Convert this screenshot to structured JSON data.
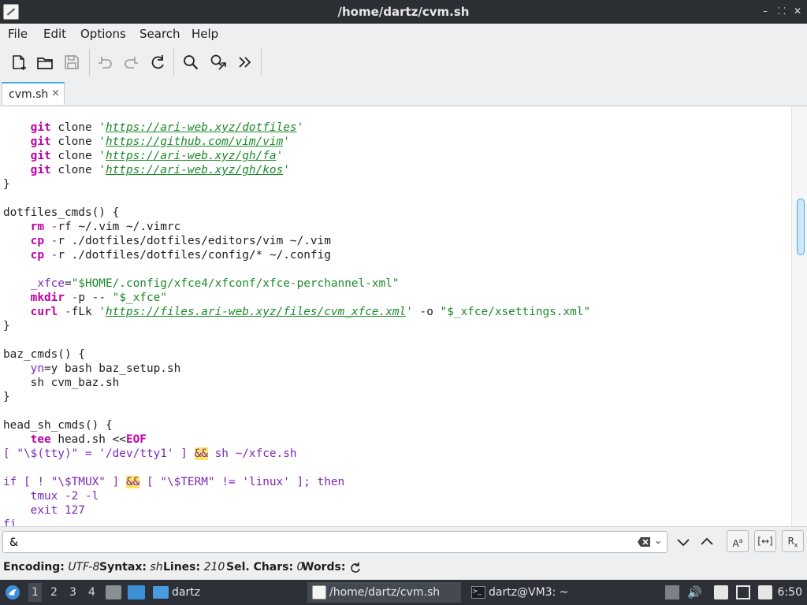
{
  "window": {
    "title": "/home/dartz/cvm.sh"
  },
  "menu": {
    "items": [
      "File",
      "Edit",
      "Options",
      "Search",
      "Help"
    ]
  },
  "tabs": [
    {
      "label": "cvm.sh",
      "close": "×"
    }
  ],
  "search": {
    "value": "&"
  },
  "status": {
    "encoding_label": "Encoding:",
    "encoding_value": "UTF-8",
    "syntax_label": "Syntax:",
    "syntax_value": "sh",
    "lines_label": "Lines:",
    "lines_value": "210",
    "selchars_label": "Sel. Chars:",
    "selchars_value": "0",
    "words_label": "Words:"
  },
  "taskbar": {
    "workspaces": [
      "1",
      "2",
      "3",
      "4"
    ],
    "folder_label": "dartz",
    "tasks": [
      {
        "label": "/home/dartz/cvm.sh"
      },
      {
        "label": "dartz@VM3: ~"
      }
    ],
    "clock": "6:50"
  },
  "code_lines": [
    [
      [
        "    ",
        ""
      ],
      [
        "git",
        "k"
      ],
      [
        " clone ",
        ""
      ],
      [
        "'",
        "s"
      ],
      [
        "https://ari-web.xyz/dotfiles",
        "u"
      ],
      [
        "'",
        "s"
      ]
    ],
    [
      [
        "    ",
        ""
      ],
      [
        "git",
        "k"
      ],
      [
        " clone ",
        ""
      ],
      [
        "'",
        "s"
      ],
      [
        "https://github.com/vim/vim",
        "u"
      ],
      [
        "'",
        "s"
      ]
    ],
    [
      [
        "    ",
        ""
      ],
      [
        "git",
        "k"
      ],
      [
        " clone ",
        ""
      ],
      [
        "'",
        "s"
      ],
      [
        "https://ari-web.xyz/gh/fa",
        "u"
      ],
      [
        "'",
        "s"
      ]
    ],
    [
      [
        "    ",
        ""
      ],
      [
        "git",
        "k"
      ],
      [
        " clone ",
        ""
      ],
      [
        "'",
        "s"
      ],
      [
        "https://ari-web.xyz/gh/kos",
        "u"
      ],
      [
        "'",
        "s"
      ]
    ],
    [
      [
        "}",
        ""
      ]
    ],
    [
      [
        "",
        ""
      ]
    ],
    [
      [
        "dotfiles_cmds() {",
        ""
      ]
    ],
    [
      [
        "    ",
        ""
      ],
      [
        "rm",
        "k"
      ],
      [
        " ",
        ""
      ],
      [
        "-",
        "p"
      ],
      [
        "rf ",
        ""
      ],
      [
        "~/",
        ""
      ],
      [
        ".vim ",
        ""
      ],
      [
        "~/",
        ""
      ],
      [
        ".vimrc",
        ""
      ]
    ],
    [
      [
        "    ",
        ""
      ],
      [
        "cp",
        "k"
      ],
      [
        " ",
        ""
      ],
      [
        "-",
        "p"
      ],
      [
        "r ./dotfiles/dotfiles/editors/vim ",
        ""
      ],
      [
        "~/",
        ""
      ],
      [
        ".vim",
        ""
      ]
    ],
    [
      [
        "    ",
        ""
      ],
      [
        "cp",
        "k"
      ],
      [
        " ",
        ""
      ],
      [
        "-",
        "p"
      ],
      [
        "r ./dotfiles/dotfiles/config/",
        ""
      ],
      [
        "*",
        ""
      ],
      [
        " ",
        ""
      ],
      [
        "~/",
        ""
      ],
      [
        ".config",
        ""
      ]
    ],
    [
      [
        "",
        ""
      ]
    ],
    [
      [
        "    ",
        ""
      ],
      [
        "_xfce",
        "v"
      ],
      [
        "=",
        ""
      ],
      [
        "\"$HOME/.config/xfce4/xfconf/xfce-perchannel-xml\"",
        "s"
      ]
    ],
    [
      [
        "    ",
        ""
      ],
      [
        "mkdir",
        "k"
      ],
      [
        " ",
        ""
      ],
      [
        "-",
        "p"
      ],
      [
        "p -- ",
        ""
      ],
      [
        "\"$_xfce\"",
        "s"
      ]
    ],
    [
      [
        "    ",
        ""
      ],
      [
        "curl",
        "k"
      ],
      [
        " ",
        ""
      ],
      [
        "-",
        "p"
      ],
      [
        "fLk ",
        ""
      ],
      [
        "'",
        "s"
      ],
      [
        "https://files.ari-web.xyz/files/cvm_xfce.xml",
        "u"
      ],
      [
        "'",
        "s"
      ],
      [
        " -o ",
        ""
      ],
      [
        "\"$_xfce/xsettings.xml\"",
        "s"
      ]
    ],
    [
      [
        "}",
        ""
      ]
    ],
    [
      [
        "",
        ""
      ]
    ],
    [
      [
        "baz_cmds() {",
        ""
      ]
    ],
    [
      [
        "    ",
        ""
      ],
      [
        "yn",
        "v"
      ],
      [
        "=",
        ""
      ],
      [
        "y bash baz_setup.sh",
        ""
      ]
    ],
    [
      [
        "    sh cvm_baz.sh",
        ""
      ]
    ],
    [
      [
        "}",
        ""
      ]
    ],
    [
      [
        "",
        ""
      ]
    ],
    [
      [
        "head_sh_cmds() {",
        ""
      ]
    ],
    [
      [
        "    ",
        ""
      ],
      [
        "tee",
        "k"
      ],
      [
        " head.sh <<",
        ""
      ],
      [
        "EOF",
        "k"
      ]
    ],
    [
      [
        "[ \"\\$(tty)\" = '/dev/tty1' ] ",
        "p"
      ],
      [
        "&&",
        "hlp"
      ],
      [
        " sh ~/xfce.sh",
        "p"
      ]
    ],
    [
      [
        "",
        ""
      ]
    ],
    [
      [
        "if [ ! \"\\$TMUX\" ] ",
        "p"
      ],
      [
        "&&",
        "hlp"
      ],
      [
        " [ \"\\$TERM\" != 'linux' ]; then",
        "p"
      ]
    ],
    [
      [
        "    tmux -2 -l",
        "p"
      ]
    ],
    [
      [
        "    exit 127",
        "p"
      ]
    ],
    [
      [
        "fi",
        "p"
      ]
    ]
  ]
}
